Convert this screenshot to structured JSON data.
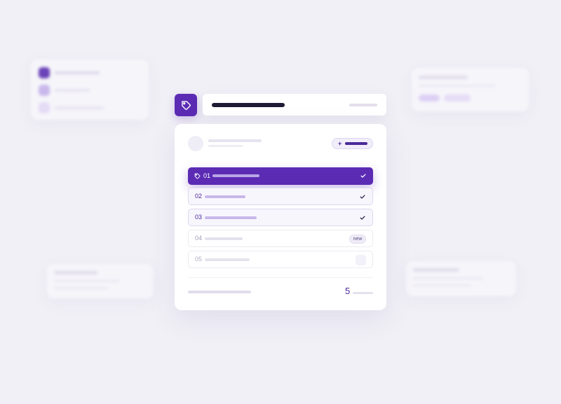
{
  "tag_list": {
    "rows": [
      {
        "number": "01",
        "state": "selected",
        "checked": true
      },
      {
        "number": "02",
        "state": "active",
        "checked": true
      },
      {
        "number": "03",
        "state": "active",
        "checked": true
      },
      {
        "number": "04",
        "state": "pending",
        "badge": "new"
      },
      {
        "number": "05",
        "state": "empty"
      }
    ],
    "footer_count": "5"
  },
  "icons": {
    "header": "tag-icon",
    "selected_row": "tag-icon",
    "row_check": "check-icon",
    "chip": "plus-icon"
  },
  "colors": {
    "accent": "#5b2bb4",
    "accent_dark": "#4a2a9a",
    "background": "#f1f0f6",
    "card": "#ffffff"
  }
}
